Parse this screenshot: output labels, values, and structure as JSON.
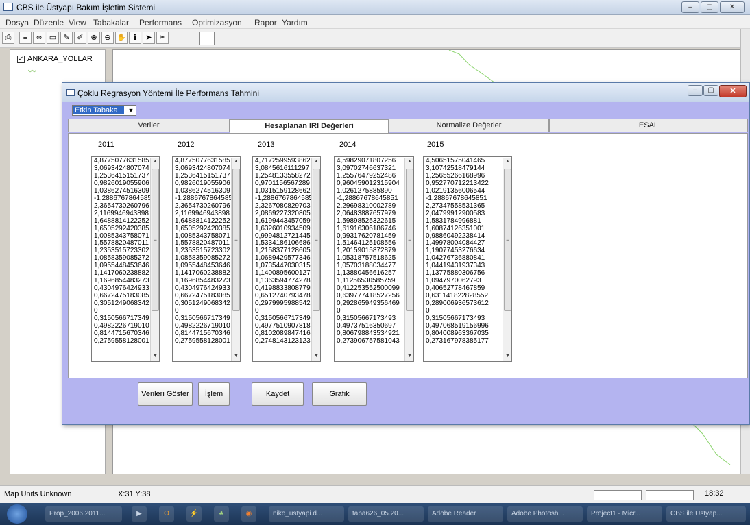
{
  "app": {
    "title": "CBS ile Üstyapı Bakım İşletim Sistemi",
    "window_controls": [
      "minimize-icon",
      "maximize-icon",
      "close-icon"
    ]
  },
  "menu": [
    "Dosya",
    "Düzenle",
    "View",
    "Tabakalar",
    "Performans",
    "Optimizasyon",
    "Rapor",
    "Yardım"
  ],
  "toc": {
    "layer_label": "ANKARA_YOLLAR",
    "checked": true
  },
  "dialog": {
    "title": "Çoklu Regrasyon Yöntemi İle Performans Tahmini",
    "layer_select_value": "Etkin Tabaka",
    "tabs": [
      "Veriler",
      "Hesaplanan IRI Değerleri",
      "Normalize Değerler",
      "ESAL"
    ],
    "active_tab": 1,
    "years": [
      "2011",
      "2012",
      "2013",
      "2014",
      "2015"
    ],
    "lists": [
      [
        "4,8775077631585",
        "3,0693424807074",
        "1,2536415151737",
        "0,9826019055906",
        "1,0386274516309",
        "-1,2886767864585",
        "2,3654730260796",
        "2,1169946943898",
        "1,6488814122252",
        "1,6505292420385",
        "1,0085343758071",
        "1,5578820487011",
        "1,2353515723302",
        "1,0858359085272",
        "1,0955448453646",
        "1,1417060238882",
        "1,1696854483273",
        "0,4304976424933",
        "0,6672475183085",
        "0,3051249068342",
        "0",
        "0,3150566717349",
        "0,4982226719010",
        "0,8144715670346",
        "0,2759558128001"
      ],
      [
        "4,8775077631585",
        "3,0693424807074",
        "1,2536415151737",
        "0,9826019055906",
        "1,0386274516309",
        "-1,2886767864585",
        "2,3654730260796",
        "2,1169946943898",
        "1,6488814122252",
        "1,6505292420385",
        "1,0085343758071",
        "1,5578820487011",
        "1,2353515723302",
        "1,0858359085272",
        "1,0955448453646",
        "1,1417060238882",
        "1,1696854483273",
        "0,4304976424933",
        "0,6672475183085",
        "0,3051249068342",
        "0",
        "0,3150566717349",
        "0,4982226719010",
        "0,8144715670346",
        "0,2759558128001"
      ],
      [
        "4,7172599593862",
        "3,0845616111297",
        "1,2548133558272",
        "0,9701156567289",
        "1,0315159128662",
        "-1,2886767864585",
        "2,3267080829703",
        "2,0869227320805",
        "1,6199443457059",
        "1,6326010934509",
        "0,9994812721445",
        "1,5334186106686",
        "1,2158377128605",
        "1,0689429577346",
        "1,0735447030315",
        "1,1400895600127",
        "1,1363594774278",
        "0,4198833808779",
        "0,6512740793478",
        "0,2979995988542",
        "0",
        "0,3150566717349",
        "0,4977510907818",
        "0,8102089847416",
        "0,2748143123123"
      ],
      [
        "4,59829071807256",
        "3,09702746637321",
        "1,25576479252486",
        "0,960459012315904",
        "1,0261275885890",
        "-1,28867678645851",
        "2,29698310002789",
        "2,06483887657979",
        "1,59898525322615",
        "1,61916306186746",
        "0,99317620781459",
        "1,51464125108556",
        "1,20159015872879",
        "1,05318757518625",
        "1,05703188034477",
        "1,13880456616257",
        "1,11256530585759",
        "0,412253552500099",
        "0,639777418527256",
        "0,292865949356469",
        "0",
        "0,31505667173493",
        "0,49737516350697",
        "0,806798843534921",
        "0,273906757581043"
      ],
      [
        "4,50651575041465",
        "3,10742518479144",
        "1,25655266168996",
        "0,952770712213422",
        "1,02191356006544",
        "-1,28867678645851",
        "2,27347558531365",
        "2,04799912900583",
        "1,5831784996881",
        "1,60874126351001",
        "0,98860492238414",
        "1,49978004084427",
        "1,19077453276634",
        "1,04276736880841",
        "1,04419431937343",
        "1,13775880306756",
        "1,0947970062793",
        "0,40652778467859",
        "0,631141822828552",
        "0,289006936573612",
        "0",
        "0,31505667173493",
        "0,497068519156996",
        "0,804008963367035",
        "0,273167978385177"
      ]
    ],
    "buttons": [
      "Verileri Göster",
      "İşlem",
      "Kaydet",
      "Grafik"
    ]
  },
  "status": {
    "units": "Map Units Unknown",
    "coords": "X:31 Y:38",
    "time": "18:32"
  },
  "taskbar": {
    "items": [
      "Prop_2006.2011...",
      "",
      "",
      "",
      "",
      "",
      "niko_ustyapi.d...",
      "tapa626_05.20...",
      "Adobe Reader",
      "Adobe Photosh...",
      "Project1 - Micr...",
      "CBS ile Ustyap..."
    ]
  }
}
